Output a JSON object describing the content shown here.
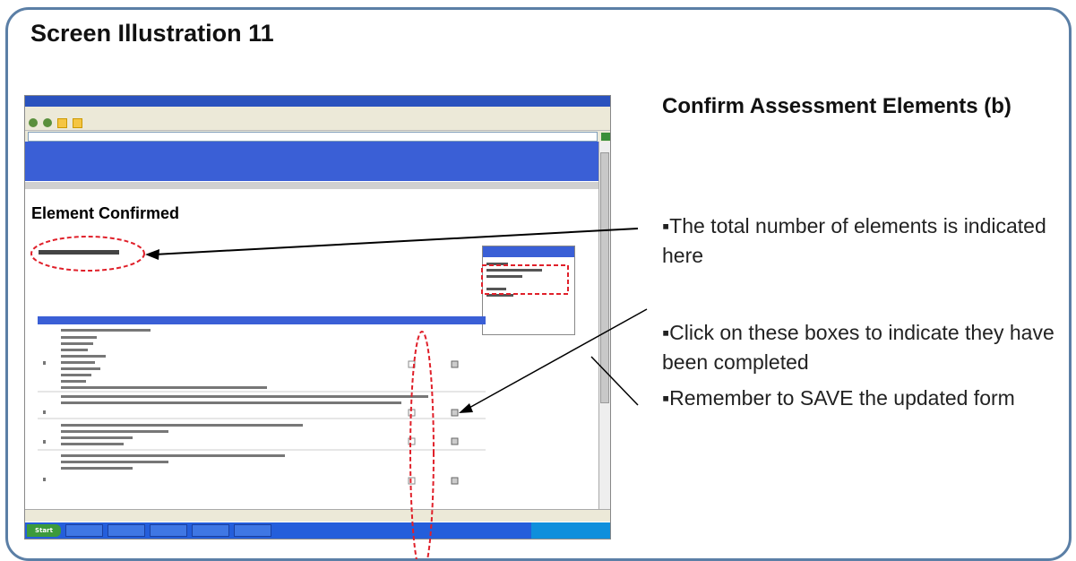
{
  "slide_title": "Screen Illustration 11",
  "heading": "Confirm Assessment Elements (b)",
  "bullets": [
    "▪The total number of elements is indicated here",
    "▪Click on these boxes to indicate they have been completed",
    "▪Remember to SAVE the updated form"
  ],
  "screenshot": {
    "page_heading": "Element Confirmed",
    "start_label": "Start"
  },
  "colors": {
    "frame_border": "#5b7fa6",
    "banner_blue": "#3a5fd6",
    "annotation_red": "#e0202a"
  }
}
